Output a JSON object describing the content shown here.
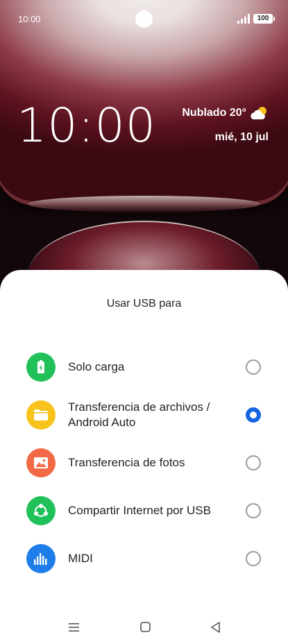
{
  "status_bar": {
    "time": "10:00",
    "battery": "100",
    "icons": [
      "camera-cutout",
      "signal-icon",
      "battery-icon"
    ]
  },
  "lockscreen": {
    "clock": "10:00",
    "weather": "Nublado 20°",
    "weather_icon": "cloudy-sun-icon",
    "date": "mié, 10 jul"
  },
  "usb_sheet": {
    "title": "Usar USB para",
    "options": [
      {
        "label": "Solo carga",
        "icon": "battery-charging-icon",
        "color": "#21c15a",
        "selected": false
      },
      {
        "label": "Transferencia de archivos / Android Auto",
        "icon": "folder-icon",
        "color": "#f7c31c",
        "selected": true
      },
      {
        "label": "Transferencia de fotos",
        "icon": "image-icon",
        "color": "#f26a45",
        "selected": false
      },
      {
        "label": "Compartir Internet por USB",
        "icon": "share-icon",
        "color": "#21c15a",
        "selected": false
      },
      {
        "label": "MIDI",
        "icon": "equalizer-icon",
        "color": "#1e7de8",
        "selected": false
      }
    ]
  },
  "nav_bar": {
    "buttons": [
      "menu-icon",
      "home-icon",
      "back-icon"
    ]
  },
  "colors": {
    "accent": "#1565e0",
    "sheet_bg": "#ffffff",
    "text": "#222222"
  }
}
